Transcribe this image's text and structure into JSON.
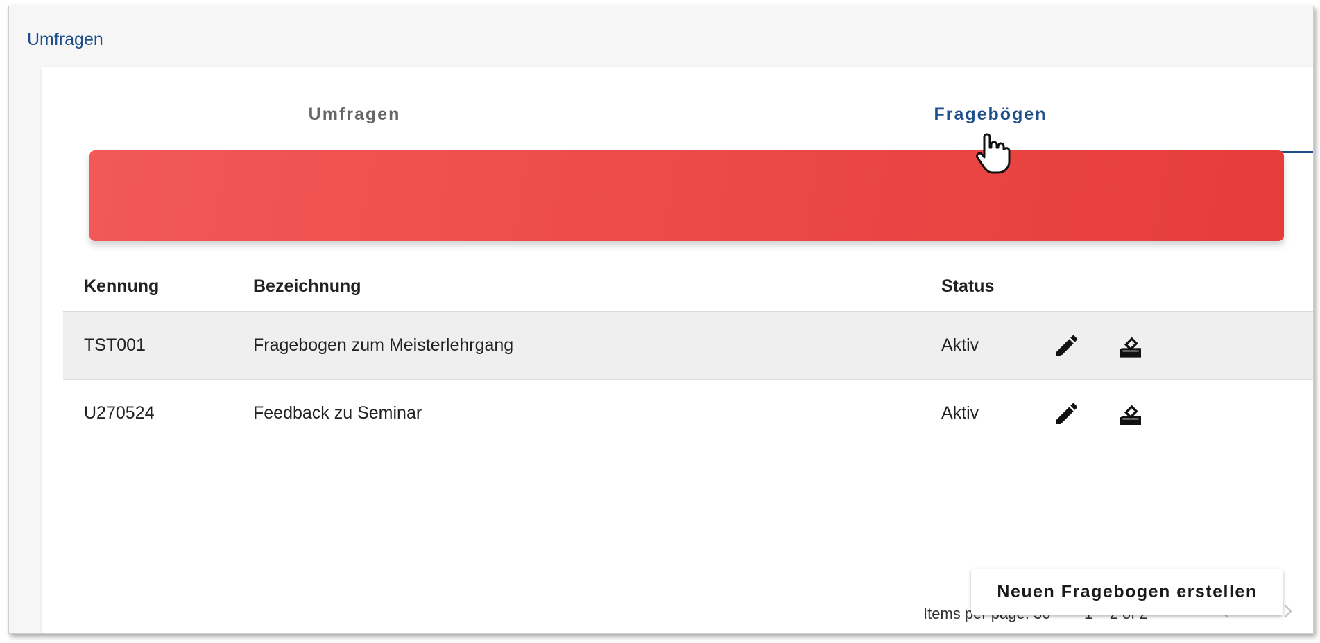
{
  "breadcrumb": "Umfragen",
  "tabs": [
    {
      "label": "Umfragen",
      "active": false
    },
    {
      "label": "Fragebögen",
      "active": true
    }
  ],
  "colors": {
    "accent": "#1d4f8b",
    "banner_start": "#f25858",
    "banner_end": "#e53d3a"
  },
  "table": {
    "headers": {
      "id": "Kennung",
      "name": "Bezeichnung",
      "status": "Status"
    },
    "rows": [
      {
        "id": "TST001",
        "name": "Fragebogen zum Meisterlehrgang",
        "status": "Aktiv",
        "actions": [
          "edit-icon",
          "vote-icon"
        ]
      },
      {
        "id": "U270524",
        "name": "Feedback zu Seminar",
        "status": "Aktiv",
        "actions": [
          "edit-icon",
          "vote-icon"
        ]
      }
    ]
  },
  "paginator": {
    "items_per_page_label": "Items per page: 30",
    "range_label": "1 – 2 of 2"
  },
  "create_button": "Neuen Fragebogen erstellen"
}
